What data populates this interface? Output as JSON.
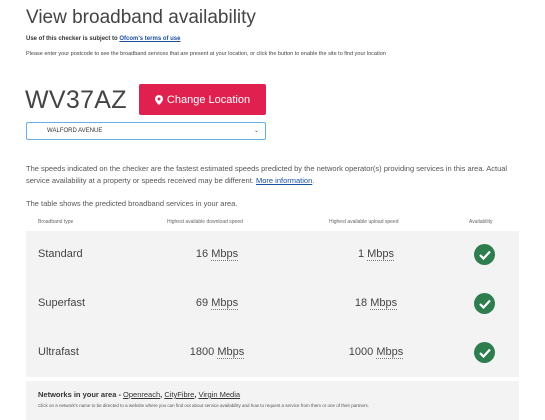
{
  "page": {
    "title": "View broadband availability",
    "terms_prefix": "Use of this checker is subject to ",
    "terms_link": "Ofcom's terms of use",
    "instructions": "Please enter your postcode to see the broadband services that are present at your location, or click the button to enable the site to find your location"
  },
  "location": {
    "postcode": "WV37AZ",
    "change_button": "Change Location",
    "address_selected": "WALFORD AVENUE"
  },
  "notes": {
    "speeds_text": "The speeds indicated on the checker are the fastest estimated speeds predicted by the network operator(s) providing services in this area. Actual service availability at a property or speeds received may be different. ",
    "more_info_link": "More information",
    "more_info_suffix": ".",
    "table_intro": "The table shows the predicted broadband services in your area."
  },
  "table": {
    "headers": {
      "type": "Broadband type",
      "download": "Highest available download speed",
      "upload": "Highest available upload speed",
      "availability": "Availability"
    },
    "rows": [
      {
        "type": "Standard",
        "down_value": "16",
        "down_unit": "Mbps",
        "up_value": "1",
        "up_unit": "Mbps",
        "available": true
      },
      {
        "type": "Superfast",
        "down_value": "69",
        "down_unit": "Mbps",
        "up_value": "18",
        "up_unit": "Mbps",
        "available": true
      },
      {
        "type": "Ultrafast",
        "down_value": "1800",
        "down_unit": "Mbps",
        "up_value": "1000",
        "up_unit": "Mbps",
        "available": true
      }
    ]
  },
  "networks": {
    "label": "Networks in your area - ",
    "items": [
      "Openreach",
      "CityFibre",
      "Virgin Media"
    ],
    "hint": "Click on a network's name to be directed to a website where you can find out about service availability and how to request a service from them or one of their partners."
  },
  "colors": {
    "accent": "#e0204f",
    "available_green": "#2e7d4f",
    "link": "#1a4fa0"
  }
}
